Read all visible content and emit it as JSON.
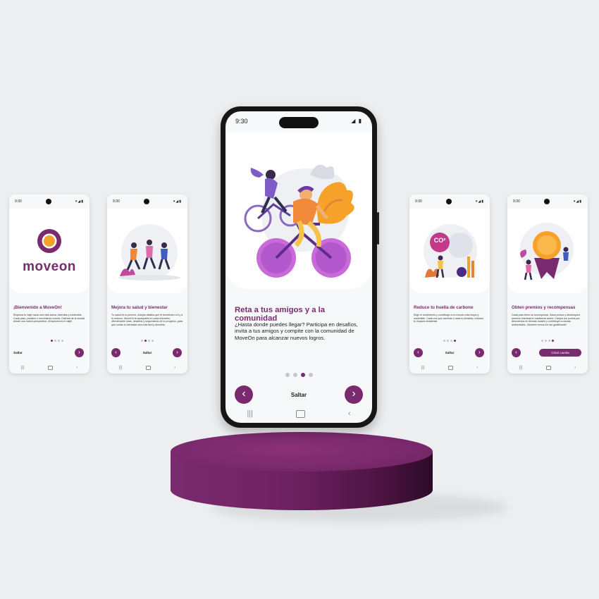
{
  "colors": {
    "accent": "#7a2a6f",
    "background": "#eceeef",
    "dot_inactive": "#c6c6ce"
  },
  "icons": {
    "next": "chevron-right-icon",
    "back": "chevron-left-icon"
  },
  "main_phone": {
    "time": "9:30",
    "title": "Reta a tus amigos y a la comunidad",
    "description": "¿Hasta donde puedes llegar? Participa en desafíos, invita a tus amigos y compite con la comunidad de MoveOn para alcanzar nuevos logros.",
    "skip_label": "Saltar",
    "next_glyph": "›",
    "back_glyph": "‹",
    "active_step": 3,
    "total_steps": 4
  },
  "screens": [
    {
      "time": "9:30",
      "logo_text": "moveon",
      "title": "¡Bienvenido a MoveOn!",
      "description": "Empieza tu viaje hacia una vida activa, divertida y sostenible. Cada paso, pedaleo o movimiento cuenta. Disfruta de la ciudad desde una nueva perspectiva. ¡Empecemos el viaje!",
      "skip_label": "Saltar",
      "active_step": 1
    },
    {
      "time": "9:30",
      "title": "Mejora tu salud y bienestar",
      "description": "Tu salud es lo primero. Adopta hábitos que te beneficien a ti y a tu entorno. MoveOn te acompaña en cada kilómetro, ofreciéndote rutas, desafíos y seguimiento de tu progreso, para que cuidar tu bienestar sea más fácil y divertido.",
      "skip_label": "Saltar",
      "active_step": 2
    },
    {
      "time": "9:30",
      "badge_text": "CO²",
      "title": "Reduce tu huella de carbono",
      "description": "Elige el movimiento y contribuye a un mundo más limpio y sostenible. Cada vez que caminas o usas tu bicicleta, reduces tu impacto ambiental.",
      "skip_label": "Saltar",
      "active_step": 4
    },
    {
      "time": "9:30",
      "title": "Obten premios y recompensas",
      "description": "Cada paso tiene su recompensa. Gana puntos y desbloquea premios mientras te mantienes activo. Canjea tus puntos por descuentos en tiendas locales y contribuye a causas ambientales. ¡Moverte nunca fue tan gratificante!",
      "cta_label": "Crear cuenta",
      "active_step": 4
    }
  ]
}
